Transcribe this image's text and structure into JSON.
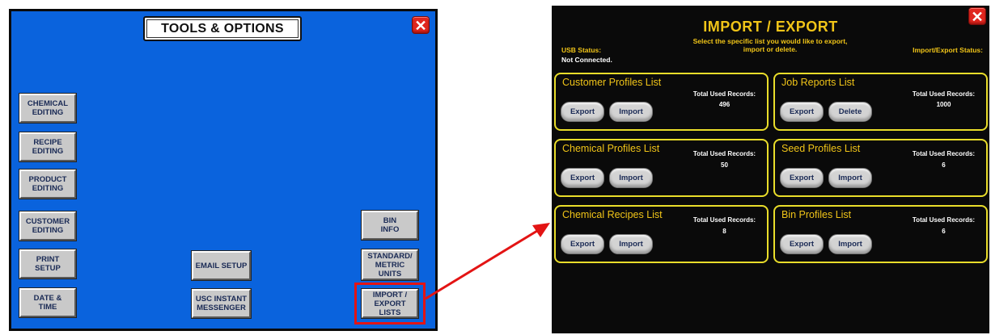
{
  "tools_panel": {
    "title": "TOOLS & OPTIONS",
    "close_symbol": "✕",
    "buttons": {
      "chemical": "CHEMICAL\nEDITING",
      "recipe": "RECIPE\nEDITING",
      "product": "PRODUCT\nEDITING",
      "customer": "CUSTOMER\nEDITING",
      "print": "PRINT\nSETUP",
      "date": "DATE &\nTIME",
      "email": "EMAIL SETUP",
      "usc": "USC INSTANT\nMESSENGER",
      "bin": "BIN\nINFO",
      "standard": "STANDARD/\nMETRIC\nUNITS",
      "import_export": "IMPORT /\nEXPORT\nLISTS"
    },
    "colors": {
      "background": "#0a63dd",
      "highlight": "#e31414"
    }
  },
  "import_export_panel": {
    "title": "IMPORT / EXPORT",
    "subtitle": "Select the specific list you would like to export, import or delete.",
    "usb_status_label": "USB Status:",
    "usb_status_value": "Not Connected.",
    "import_export_status_label": "Import/Export Status:",
    "close_symbol": "✕",
    "sections": [
      {
        "title": "Customer Profiles List",
        "used_label": "Total Used Records:",
        "used_value": "496",
        "btn1": "Export",
        "btn2": "Import"
      },
      {
        "title": "Job Reports List",
        "used_label": "Total Used Records:",
        "used_value": "1000",
        "btn1": "Export",
        "btn2": "Delete"
      },
      {
        "title": "Chemical Profiles List",
        "used_label": "Total Used Records:",
        "used_value": "50",
        "btn1": "Export",
        "btn2": "Import"
      },
      {
        "title": "Seed Profiles List",
        "used_label": "Total Used Records:",
        "used_value": "6",
        "btn1": "Export",
        "btn2": "Import"
      },
      {
        "title": "Chemical Recipes List",
        "used_label": "Total Used Records:",
        "used_value": "8",
        "btn1": "Export",
        "btn2": "Import"
      },
      {
        "title": "Bin Profiles List",
        "used_label": "Total Used Records:",
        "used_value": "6",
        "btn1": "Export",
        "btn2": "Import"
      }
    ],
    "colors": {
      "background": "#0a0a0a",
      "accent": "#f0c418",
      "border": "#e9dd2a"
    }
  },
  "arrow": {
    "icon": "red-arrow-icon",
    "color": "#e31414"
  }
}
